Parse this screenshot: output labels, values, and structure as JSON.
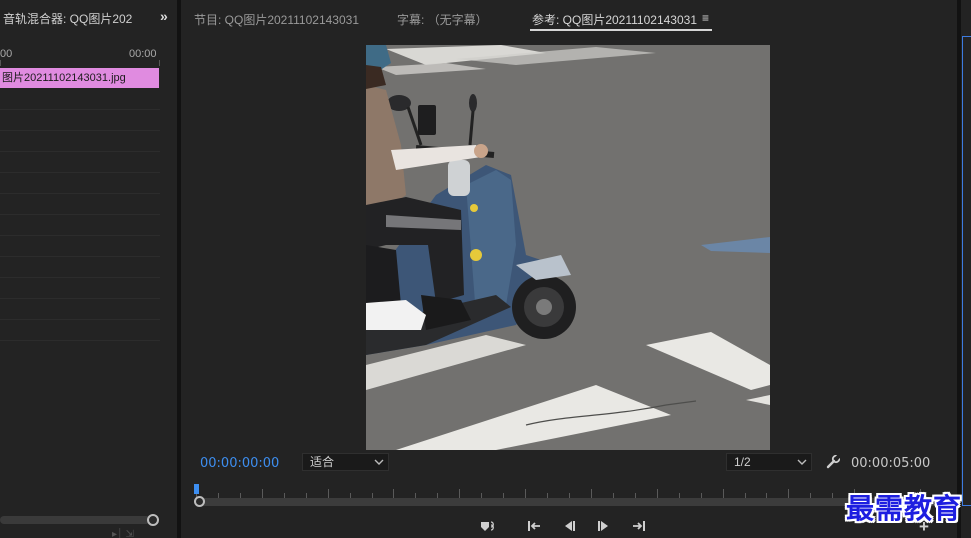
{
  "left_panel": {
    "title": "音轨混合器: QQ图片202",
    "more_icon": "double-chevron-right-icon",
    "ruler_start": "00",
    "ruler_end": "00:00",
    "clip_name": "图片20211102143031.jpg",
    "clip_color": "#e08be0"
  },
  "monitor": {
    "tabs": [
      {
        "label": "节目: QQ图片20211102143031",
        "active": false
      },
      {
        "label": "字幕: （无字幕）",
        "active": false
      },
      {
        "label": "参考: QQ图片20211102143031",
        "active": true
      }
    ],
    "menu_icon": "hamburger-menu-icon",
    "current_timecode": "00:00:00:00",
    "total_timecode": "00:00:05:00",
    "zoom_value": "适合",
    "resolution_value": "1/2",
    "accent_color": "#3d8ef0",
    "transport": {
      "marker_icon": "marker-link-icon",
      "go_to_in_icon": "go-to-in-icon",
      "step_back_icon": "step-back-icon",
      "step_forward_icon": "step-forward-icon",
      "go_to_out_icon": "go-to-out-icon",
      "add_label": "+"
    }
  },
  "watermark": "最需教育"
}
